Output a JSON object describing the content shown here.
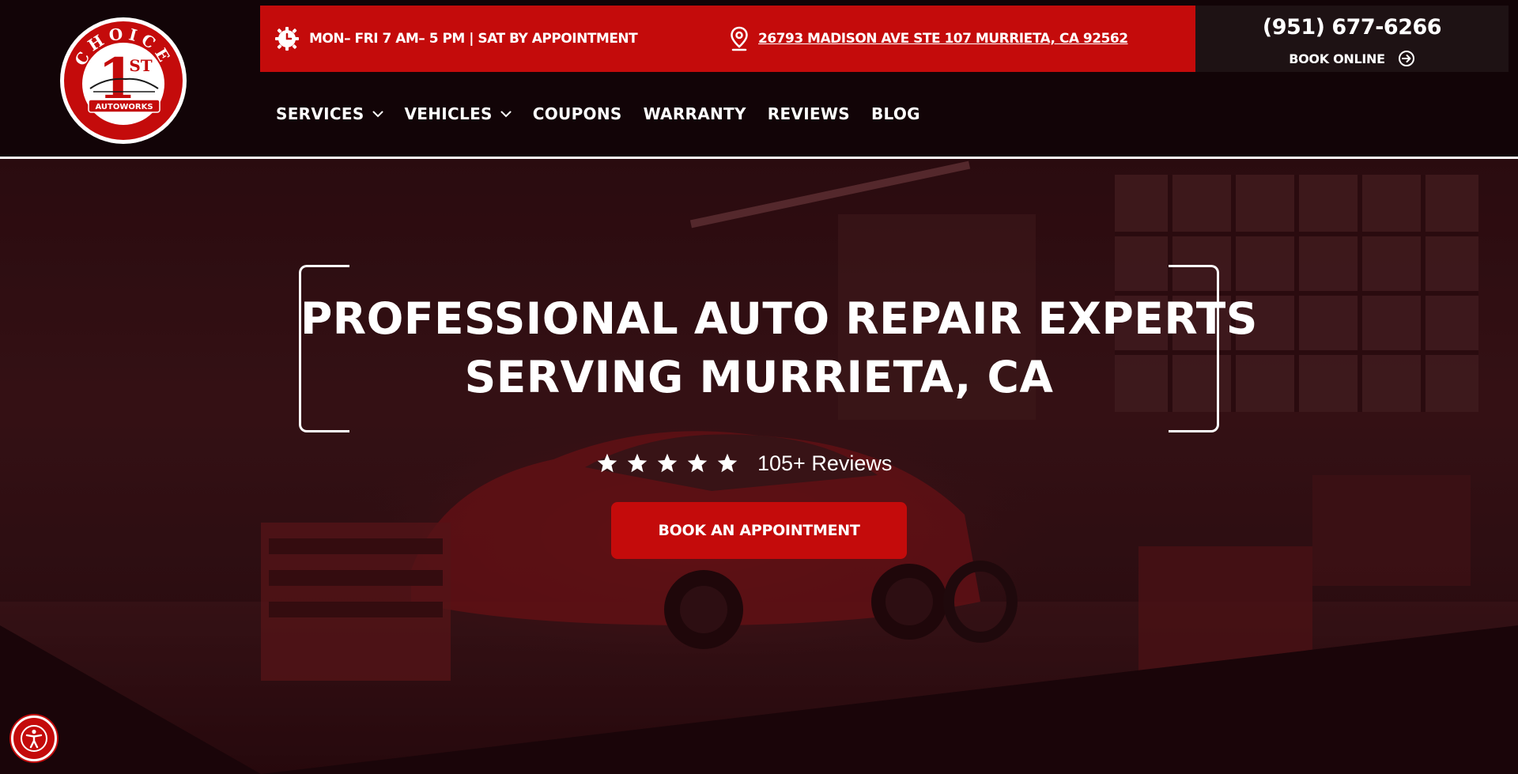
{
  "brand": {
    "logo_text_top": "CHOICE",
    "logo_numeral": "1",
    "logo_suffix": "ST",
    "logo_text_bottom": "AUTOWORKS",
    "accent_color": "#c40b0b",
    "dark_color": "#120407"
  },
  "topbar": {
    "hours": "MON– FRI 7 AM– 5 PM | SAT BY APPOINTMENT",
    "hours_icon": "clock-gear-icon",
    "address": "26793 MADISON AVE  STE 107 MURRIETA, CA 92562",
    "address_icon": "map-pin-icon"
  },
  "contact": {
    "phone": "(951) 677-6266",
    "book_online": "BOOK ONLINE",
    "book_online_icon": "sign-in-arrow-icon"
  },
  "nav": {
    "items": [
      {
        "label": "SERVICES",
        "has_dropdown": true
      },
      {
        "label": "VEHICLES",
        "has_dropdown": true
      },
      {
        "label": "COUPONS",
        "has_dropdown": false
      },
      {
        "label": "WARRANTY",
        "has_dropdown": false
      },
      {
        "label": "REVIEWS",
        "has_dropdown": false
      },
      {
        "label": "BLOG",
        "has_dropdown": false
      }
    ]
  },
  "hero": {
    "title_line1": "PROFESSIONAL AUTO REPAIR EXPERTS",
    "title_line2": "SERVING MURRIETA, CA",
    "rating_stars": 5,
    "reviews_text": "105+ Reviews",
    "cta_label": "BOOK AN APPOINTMENT"
  },
  "accessibility": {
    "icon": "accessibility-person-icon"
  }
}
